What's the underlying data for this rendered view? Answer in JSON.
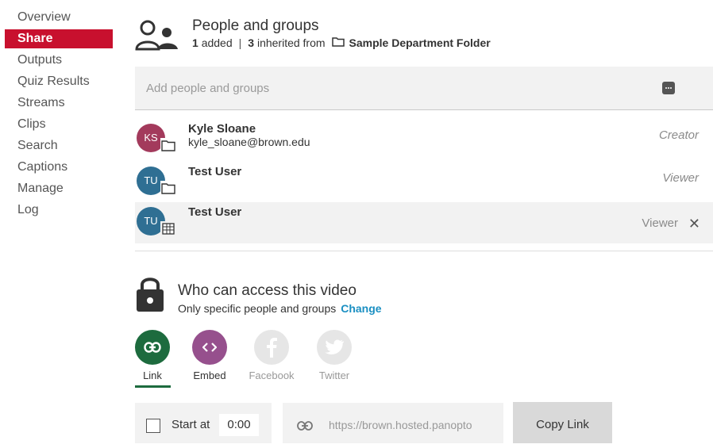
{
  "nav": {
    "items": [
      {
        "label": "Overview",
        "active": false
      },
      {
        "label": "Share",
        "active": true
      },
      {
        "label": "Outputs",
        "active": false
      },
      {
        "label": "Quiz Results",
        "active": false
      },
      {
        "label": "Streams",
        "active": false
      },
      {
        "label": "Clips",
        "active": false
      },
      {
        "label": "Search",
        "active": false
      },
      {
        "label": "Captions",
        "active": false
      },
      {
        "label": "Manage",
        "active": false
      },
      {
        "label": "Log",
        "active": false
      }
    ]
  },
  "people": {
    "title": "People and groups",
    "added_count": "1",
    "added_text": "added",
    "separator": "|",
    "inherited_count": "3",
    "inherited_text": "inherited from",
    "folder_name": "Sample Department Folder",
    "add_placeholder": "Add people and groups",
    "list": [
      {
        "initials": "KS",
        "name": "Kyle Sloane",
        "email": "kyle_sloane@brown.edu",
        "role": "Creator",
        "avatar_color": "#a33a5c",
        "badge": "folder-icon"
      },
      {
        "initials": "TU",
        "name": "Test User",
        "email": "",
        "role": "Viewer",
        "avatar_color": "#2f6f93",
        "badge": "folder-icon"
      },
      {
        "initials": "TU",
        "name": "Test User",
        "email": "",
        "role": "Viewer",
        "avatar_color": "#2f6f93",
        "badge": "building-icon",
        "remove": "✕"
      }
    ]
  },
  "access": {
    "title": "Who can access this video",
    "subtitle": "Only specific people and groups",
    "change_label": "Change"
  },
  "share_options": [
    {
      "label": "Link",
      "color": "#1d6b3e",
      "icon": "link-icon",
      "selected": true
    },
    {
      "label": "Embed",
      "color": "#96508d",
      "icon": "embed-icon",
      "selected": false
    },
    {
      "label": "Facebook",
      "color": "#e6e6e6",
      "icon": "facebook-icon",
      "selected": false
    },
    {
      "label": "Twitter",
      "color": "#e6e6e6",
      "icon": "twitter-icon",
      "selected": false
    }
  ],
  "link": {
    "start_label": "Start at",
    "start_time": "0:00",
    "url": "https://brown.hosted.panopto",
    "copy_label": "Copy Link"
  },
  "colors": {
    "accent_red": "#c8102e",
    "link_blue": "#1a8fc2"
  }
}
